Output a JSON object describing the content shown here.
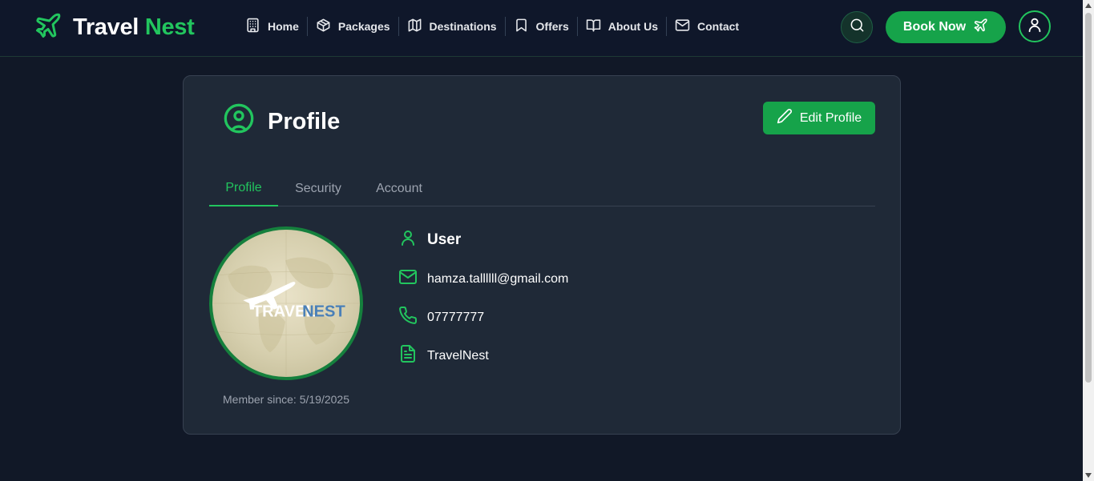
{
  "brand": {
    "name_part1": "Travel",
    "name_part2": "Nest"
  },
  "nav": {
    "items": [
      {
        "label": "Home",
        "icon": "building-icon"
      },
      {
        "label": "Packages",
        "icon": "package-icon"
      },
      {
        "label": "Destinations",
        "icon": "map-icon"
      },
      {
        "label": "Offers",
        "icon": "bookmark-icon"
      },
      {
        "label": "About Us",
        "icon": "book-open-icon"
      },
      {
        "label": "Contact",
        "icon": "mail-icon"
      }
    ]
  },
  "header": {
    "book_label": "Book Now"
  },
  "profile": {
    "title": "Profile",
    "edit_label": "Edit Profile",
    "tabs": [
      {
        "label": "Profile",
        "active": true
      },
      {
        "label": "Security",
        "active": false
      },
      {
        "label": "Account",
        "active": false
      }
    ],
    "avatar_logo_text_1": "TRAVEL",
    "avatar_logo_text_2": "NEST",
    "member_since": "Member since: 5/19/2025",
    "name": "User",
    "email": "hamza.tallllll@gmail.com",
    "phone": "07777777",
    "bio": "TravelNest"
  },
  "colors": {
    "accent": "#22c55e",
    "button": "#16a34a",
    "background": "#111827",
    "card": "#1f2937",
    "header": "#0f172a"
  }
}
